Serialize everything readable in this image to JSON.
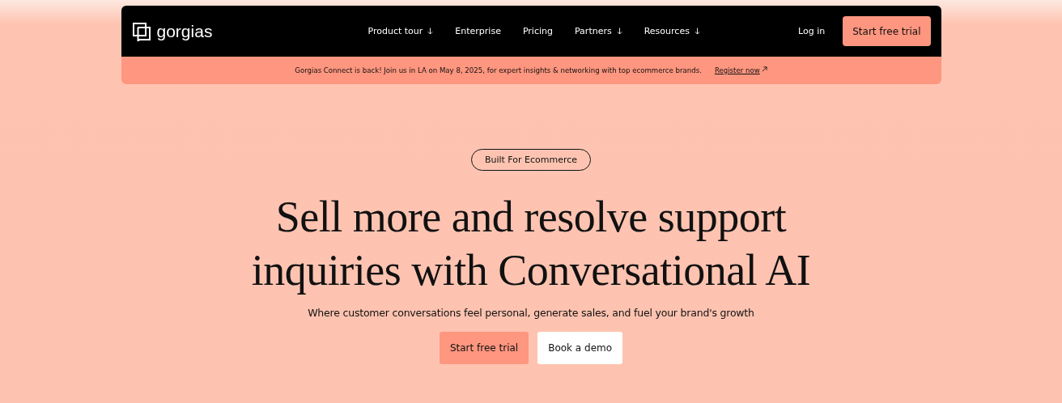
{
  "brand": {
    "name": "gorgias"
  },
  "nav": {
    "items": [
      {
        "label": "Product tour",
        "has_menu": true
      },
      {
        "label": "Enterprise",
        "has_menu": false
      },
      {
        "label": "Pricing",
        "has_menu": false
      },
      {
        "label": "Partners",
        "has_menu": true
      },
      {
        "label": "Resources",
        "has_menu": true
      }
    ],
    "login": "Log in",
    "cta": "Start free trial"
  },
  "announcement": {
    "text": "Gorgias Connect is back! Join us in LA on May 8, 2025, for expert insights & networking with top ecommerce brands.",
    "link": "Register now"
  },
  "hero": {
    "badge": "Built For Ecommerce",
    "heading_lines": [
      "Sell more and resolve support",
      "inquiries with Conversational AI"
    ],
    "subheading": "Where customer conversations feel personal, generate sales, and fuel your brand's growth",
    "buttons": [
      {
        "label": "Start free trial",
        "kind": "primary"
      },
      {
        "label": "Book a demo",
        "kind": "secondary"
      }
    ]
  }
}
